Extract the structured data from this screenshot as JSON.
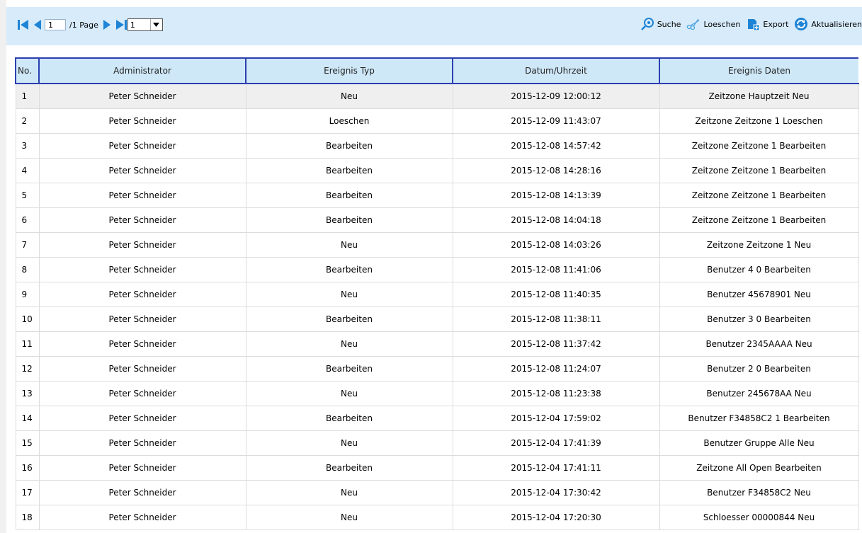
{
  "pager": {
    "current_page": "1",
    "total_text": "/1 Page",
    "select_value": "1"
  },
  "actions": {
    "search": "Suche",
    "delete": "Loeschen",
    "export": "Export",
    "refresh": "Aktualisieren"
  },
  "colors": {
    "toolbar_bg": "#d7ebfb",
    "header_bg": "#cfe8f8",
    "header_border": "#2a3fb0",
    "nav_arrow": "#1e84d6"
  },
  "table": {
    "columns": [
      "No.",
      "Administrator",
      "Ereignis Typ",
      "Datum/Uhrzeit",
      "Ereignis Daten"
    ],
    "rows": [
      [
        "1",
        "Peter Schneider",
        "Neu",
        "2015-12-09 12:00:12",
        "Zeitzone Hauptzeit Neu"
      ],
      [
        "2",
        "Peter Schneider",
        "Loeschen",
        "2015-12-09 11:43:07",
        "Zeitzone Zeitzone 1 Loeschen"
      ],
      [
        "3",
        "Peter Schneider",
        "Bearbeiten",
        "2015-12-08 14:57:42",
        "Zeitzone Zeitzone 1 Bearbeiten"
      ],
      [
        "4",
        "Peter Schneider",
        "Bearbeiten",
        "2015-12-08 14:28:16",
        "Zeitzone Zeitzone 1 Bearbeiten"
      ],
      [
        "5",
        "Peter Schneider",
        "Bearbeiten",
        "2015-12-08 14:13:39",
        "Zeitzone Zeitzone 1 Bearbeiten"
      ],
      [
        "6",
        "Peter Schneider",
        "Bearbeiten",
        "2015-12-08 14:04:18",
        "Zeitzone Zeitzone 1 Bearbeiten"
      ],
      [
        "7",
        "Peter Schneider",
        "Neu",
        "2015-12-08 14:03:26",
        "Zeitzone Zeitzone 1 Neu"
      ],
      [
        "8",
        "Peter Schneider",
        "Bearbeiten",
        "2015-12-08 11:41:06",
        "Benutzer 4 0 Bearbeiten"
      ],
      [
        "9",
        "Peter Schneider",
        "Neu",
        "2015-12-08 11:40:35",
        "Benutzer 45678901 Neu"
      ],
      [
        "10",
        "Peter Schneider",
        "Bearbeiten",
        "2015-12-08 11:38:11",
        "Benutzer 3 0 Bearbeiten"
      ],
      [
        "11",
        "Peter Schneider",
        "Neu",
        "2015-12-08 11:37:42",
        "Benutzer 2345AAAA Neu"
      ],
      [
        "12",
        "Peter Schneider",
        "Bearbeiten",
        "2015-12-08 11:24:07",
        "Benutzer 2 0 Bearbeiten"
      ],
      [
        "13",
        "Peter Schneider",
        "Neu",
        "2015-12-08 11:23:38",
        "Benutzer 245678AA Neu"
      ],
      [
        "14",
        "Peter Schneider",
        "Bearbeiten",
        "2015-12-04 17:59:02",
        "Benutzer F34858C2 1 Bearbeiten"
      ],
      [
        "15",
        "Peter Schneider",
        "Neu",
        "2015-12-04 17:41:39",
        "Benutzer Gruppe Alle Neu"
      ],
      [
        "16",
        "Peter Schneider",
        "Bearbeiten",
        "2015-12-04 17:41:11",
        "Zeitzone All Open Bearbeiten"
      ],
      [
        "17",
        "Peter Schneider",
        "Neu",
        "2015-12-04 17:30:42",
        "Benutzer F34858C2 Neu"
      ],
      [
        "18",
        "Peter Schneider",
        "Neu",
        "2015-12-04 17:20:30",
        "Schloesser 00000844 Neu"
      ]
    ]
  }
}
